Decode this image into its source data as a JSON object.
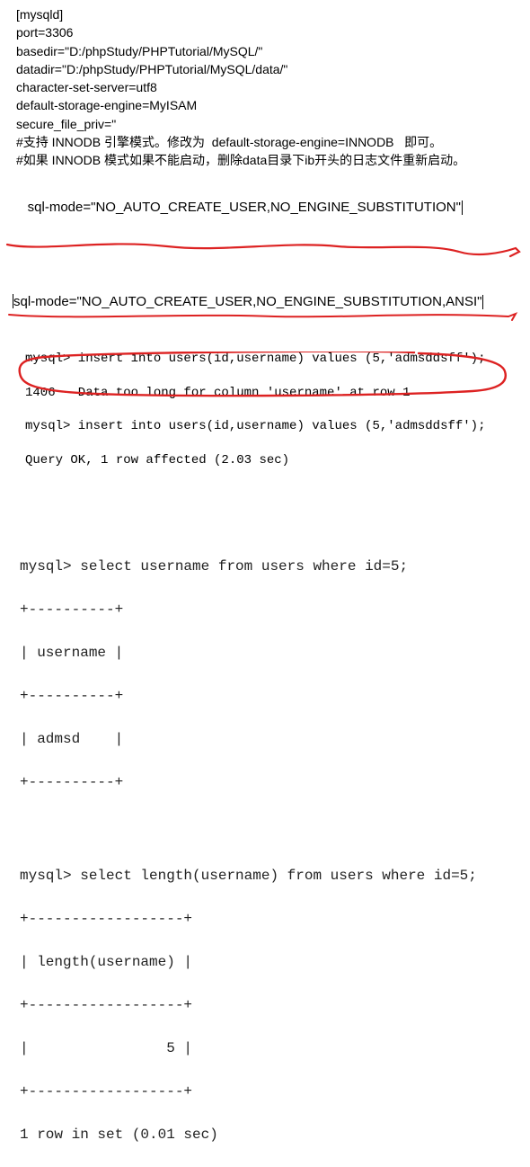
{
  "config": {
    "line1": "[mysqld]",
    "line2": "port=3306",
    "line3": "basedir=\"D:/phpStudy/PHPTutorial/MySQL/\"",
    "line4": "datadir=\"D:/phpStudy/PHPTutorial/MySQL/data/\"",
    "line5": "character-set-server=utf8",
    "line6": "default-storage-engine=MyISAM",
    "line7": "secure_file_priv=\"",
    "line8": "#支持 INNODB 引擎模式。修改为  default-storage-engine=INNODB   即可。",
    "line9": "#如果 INNODB 模式如果不能启动，删除data目录下ib开头的日志文件重新启动。",
    "line10": "sql-mode=\"NO_AUTO_CREATE_USER,NO_ENGINE_SUBSTITUTION\""
  },
  "sqlModeEdited": "sql-mode=\"NO_AUTO_CREATE_USER,NO_ENGINE_SUBSTITUTION,ANSI\"",
  "terminal1": {
    "l1": "mysql> insert into users(id,username) values (5,'admsddsff');",
    "l2": "1406 - Data too long for column 'username' at row 1",
    "l3": "mysql> insert into users(id,username) values (5,'admsddsff');",
    "l4": "Query OK, 1 row affected (2.03 sec)"
  },
  "output1": {
    "l1": "mysql> select username from users where id=5;",
    "l2": "+----------+",
    "l3": "| username |",
    "l4": "+----------+",
    "l5": "| admsd    |",
    "l6": "+----------+"
  },
  "output2": {
    "l1": "mysql> select length(username) from users where id=5;",
    "l2": "+------------------+",
    "l3": "| length(username) |",
    "l4": "+------------------+",
    "l5": "|                5 |",
    "l6": "+------------------+",
    "l7": "1 row in set (0.01 sec)"
  }
}
